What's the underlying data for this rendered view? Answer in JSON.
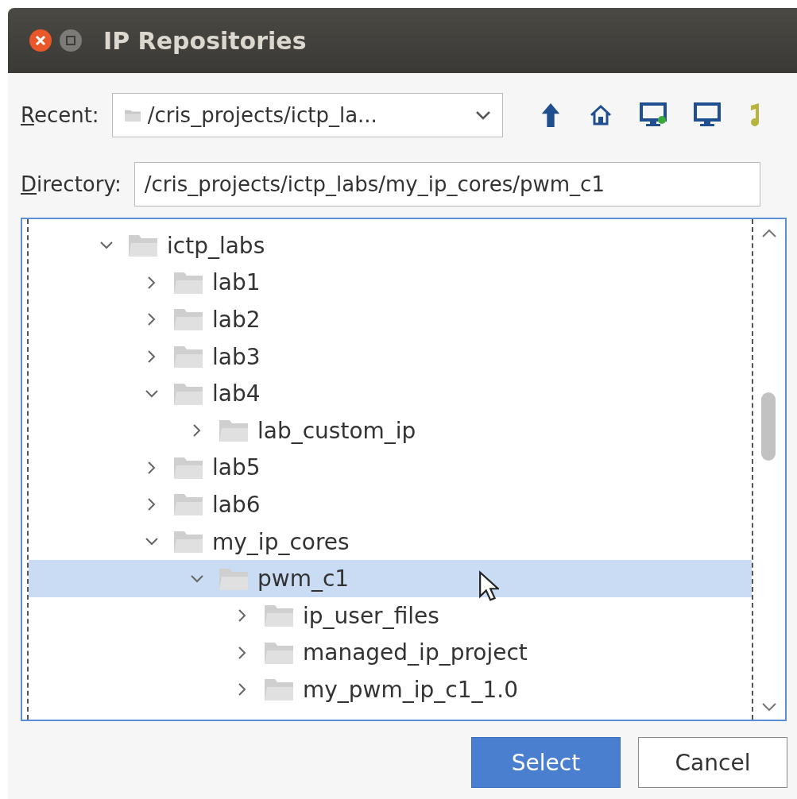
{
  "window": {
    "title": "IP Repositories"
  },
  "recent": {
    "label": "Recent:",
    "value": "/cris_projects/ictp_la..."
  },
  "directory": {
    "label": "Directory:",
    "value": "/cris_projects/ictp_labs/my_ip_cores/pwm_c1"
  },
  "tree": [
    {
      "label": "ictp_labs",
      "expanded": true,
      "selected": false,
      "children": [
        {
          "label": "lab1",
          "expanded": false,
          "selected": false
        },
        {
          "label": "lab2",
          "expanded": false,
          "selected": false
        },
        {
          "label": "lab3",
          "expanded": false,
          "selected": false
        },
        {
          "label": "lab4",
          "expanded": true,
          "selected": false,
          "children": [
            {
              "label": "lab_custom_ip",
              "expanded": false,
              "selected": false
            }
          ]
        },
        {
          "label": "lab5",
          "expanded": false,
          "selected": false
        },
        {
          "label": "lab6",
          "expanded": false,
          "selected": false
        },
        {
          "label": "my_ip_cores",
          "expanded": true,
          "selected": false,
          "children": [
            {
              "label": "pwm_c1",
              "expanded": true,
              "selected": true,
              "children": [
                {
                  "label": "ip_user_files",
                  "expanded": false,
                  "selected": false
                },
                {
                  "label": "managed_ip_project",
                  "expanded": false,
                  "selected": false
                },
                {
                  "label": "my_pwm_ip_c1_1.0",
                  "expanded": false,
                  "selected": false
                }
              ]
            }
          ]
        }
      ]
    }
  ],
  "buttons": [
    {
      "label": "Select",
      "kind": "primary"
    },
    {
      "label": "Cancel",
      "kind": "secondary"
    }
  ]
}
